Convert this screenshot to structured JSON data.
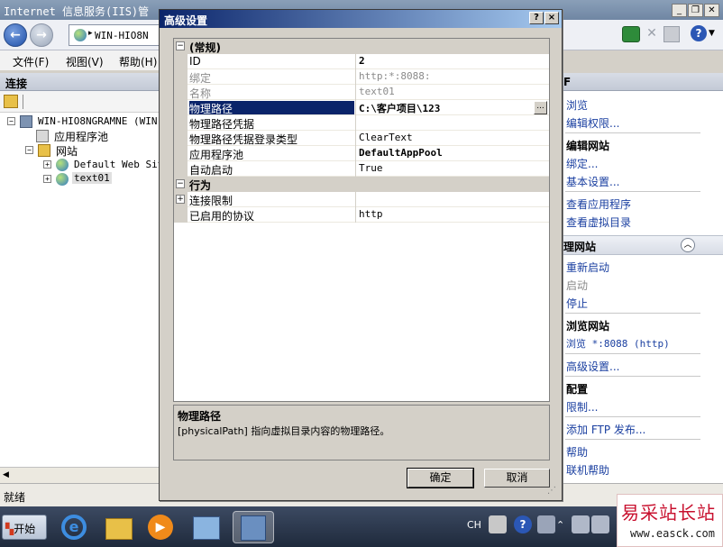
{
  "main_window": {
    "title": "Internet 信息服务(IIS)管",
    "address_text": "WIN-HIO8N",
    "menu": [
      "文件(F)",
      "视图(V)",
      "帮助(H)"
    ]
  },
  "connections": {
    "header": "连接",
    "tree": [
      {
        "label": "WIN-HIO8NGRAMNE (WIN-H",
        "level": 0,
        "expander": "−"
      },
      {
        "label": "应用程序池",
        "level": 1,
        "expander": ""
      },
      {
        "label": "网站",
        "level": 1,
        "expander": "−"
      },
      {
        "label": "Default Web Site",
        "level": 2,
        "expander": "+"
      },
      {
        "label": "text01",
        "level": 2,
        "expander": "+"
      }
    ]
  },
  "status_bar": {
    "text": "就绪"
  },
  "actions": {
    "header": "F",
    "items": [
      {
        "type": "link",
        "label": "浏览"
      },
      {
        "type": "link",
        "label": "编辑权限..."
      },
      {
        "type": "head",
        "label": "编辑网站"
      },
      {
        "type": "link",
        "label": "绑定..."
      },
      {
        "type": "link",
        "label": "基本设置..."
      },
      {
        "type": "link",
        "label": "查看应用程序"
      },
      {
        "type": "link",
        "label": "查看虚拟目录"
      },
      {
        "type": "bar",
        "label": "理网站"
      },
      {
        "type": "link",
        "label": "重新启动"
      },
      {
        "type": "disabled",
        "label": "启动"
      },
      {
        "type": "link",
        "label": "停止"
      },
      {
        "type": "head",
        "label": "浏览网站"
      },
      {
        "type": "link",
        "label": "浏览 *:8088 (http)"
      },
      {
        "type": "link",
        "label": "高级设置..."
      },
      {
        "type": "head",
        "label": "配置"
      },
      {
        "type": "link",
        "label": "限制..."
      },
      {
        "type": "link",
        "label": "添加 FTP 发布..."
      },
      {
        "type": "link",
        "label": "帮助"
      },
      {
        "type": "link",
        "label": "联机帮助"
      }
    ]
  },
  "dialog": {
    "title": "高级设置",
    "help_btn": "?",
    "close_btn": "×",
    "categories": [
      {
        "label": "(常规)",
        "expander": "−",
        "props": [
          {
            "name": "ID",
            "value": "2",
            "state": "normal",
            "bold": true
          },
          {
            "name": "绑定",
            "value": "http:*:8088:",
            "state": "disabled",
            "bold": false
          },
          {
            "name": "名称",
            "value": "text01",
            "state": "disabled",
            "bold": false
          },
          {
            "name": "物理路径",
            "value": "C:\\客户项目\\123",
            "state": "selected",
            "bold": true
          },
          {
            "name": "物理路径凭据",
            "value": "",
            "state": "normal",
            "bold": false
          },
          {
            "name": "物理路径凭据登录类型",
            "value": "ClearText",
            "state": "normal",
            "bold": false
          },
          {
            "name": "应用程序池",
            "value": "DefaultAppPool",
            "state": "normal",
            "bold": true
          },
          {
            "name": "自动启动",
            "value": "True",
            "state": "normal",
            "bold": false
          }
        ]
      },
      {
        "label": "行为",
        "expander": "−",
        "props": [
          {
            "name": "连接限制",
            "value": "",
            "state": "expandable",
            "bold": false
          },
          {
            "name": "已启用的协议",
            "value": "http",
            "state": "normal",
            "bold": false
          }
        ]
      }
    ],
    "browse_btn": "...",
    "description": {
      "title": "物理路径",
      "text": "[physicalPath] 指向虚拟目录内容的物理路径。"
    },
    "ok_label": "确定",
    "cancel_label": "取消"
  },
  "taskbar": {
    "start_label": "开始",
    "lang": "CH"
  },
  "watermark": {
    "title": "易采站长站",
    "url": "www.easck.com"
  }
}
